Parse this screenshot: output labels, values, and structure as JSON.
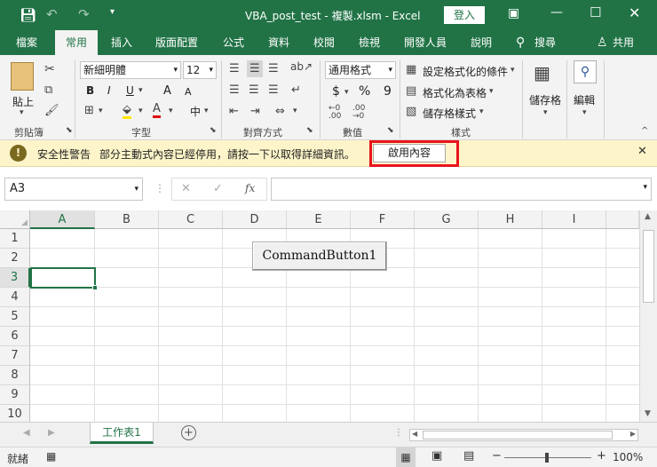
{
  "titlebar": {
    "title": "VBA_post_test - 複製.xlsm - Excel",
    "signin": "登入",
    "save_icon": "save-icon",
    "undo_icon": "undo-icon",
    "redo_icon": "redo-icon"
  },
  "tabs": [
    {
      "label": "檔案"
    },
    {
      "label": "常用"
    },
    {
      "label": "插入"
    },
    {
      "label": "版面配置"
    },
    {
      "label": "公式"
    },
    {
      "label": "資料"
    },
    {
      "label": "校閱"
    },
    {
      "label": "檢視"
    },
    {
      "label": "開發人員"
    },
    {
      "label": "說明"
    }
  ],
  "search": {
    "label": "搜尋"
  },
  "share": {
    "label": "共用"
  },
  "ribbon": {
    "clipboard": {
      "paste": "貼上",
      "group": "剪貼簿"
    },
    "font": {
      "name": "新細明體",
      "size": "12",
      "bold": "B",
      "italic": "I",
      "underline": "U",
      "grow": "A",
      "shrink": "A",
      "group": "字型",
      "phonetic": "中"
    },
    "alignment": {
      "group": "對齊方式"
    },
    "number": {
      "format": "通用格式",
      "currency": "$",
      "percent": "%",
      "comma": "9",
      "group": "數值"
    },
    "styles": {
      "conditional": "設定格式化的條件",
      "table": "格式化為表格",
      "cell": "儲存格樣式",
      "group": "樣式"
    },
    "cells": {
      "label": "儲存格"
    },
    "editing": {
      "label": "編輯"
    }
  },
  "security": {
    "title": "安全性警告",
    "message": "部分主動式內容已經停用，請按一下以取得詳細資訊。",
    "enable": "啟用內容"
  },
  "formula": {
    "namebox": "A3",
    "fx": "fx",
    "value": ""
  },
  "grid": {
    "columns": [
      "A",
      "B",
      "C",
      "D",
      "E",
      "F",
      "G",
      "H",
      "I"
    ],
    "rows": [
      "1",
      "2",
      "3",
      "4",
      "5",
      "6",
      "7",
      "8",
      "9",
      "10"
    ],
    "selected": "A3",
    "button": "CommandButton1"
  },
  "sheets": [
    {
      "label": "工作表1"
    }
  ],
  "status": {
    "ready": "就緒",
    "zoom": "100%"
  }
}
